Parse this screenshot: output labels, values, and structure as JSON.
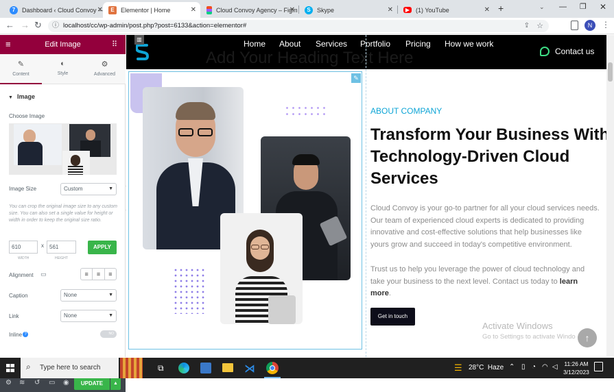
{
  "browser": {
    "tabs": [
      {
        "title": "Dashboard ‹ Cloud Convoy — ",
        "icon": "wordpress-icon",
        "color": "#2d8cff",
        "active": false
      },
      {
        "title": "Elementor | Home",
        "icon": "elementor-icon",
        "color": "#e0733f",
        "active": true
      },
      {
        "title": "Cloud Convoy Agency – Figm",
        "icon": "figma-icon",
        "color": "#f24e1e",
        "active": false
      },
      {
        "title": "Skype",
        "icon": "skype-icon",
        "color": "#00aff0",
        "active": false
      },
      {
        "title": "(1) YouTube",
        "icon": "youtube-icon",
        "color": "#ff0000",
        "active": false
      }
    ],
    "new_tab": "+",
    "url": "localhost/cc/wp-admin/post.php?post=6133&action=elementor#",
    "profile_initial": "N"
  },
  "panel": {
    "title": "Edit Image",
    "tabs": [
      {
        "label": "Content",
        "icon": "pencil-icon"
      },
      {
        "label": "Style",
        "icon": "contrast-icon"
      },
      {
        "label": "Advanced",
        "icon": "gear-icon"
      }
    ],
    "section_title": "Image",
    "choose_image_label": "Choose Image",
    "image_size_label": "Image Size",
    "image_size_value": "Custom",
    "crop_help": "You can crop the original image size to any custom size. You can also set a single value for height or width in order to keep the original size ratio.",
    "width_value": "610",
    "width_caption": "WIDTH",
    "height_value": "561",
    "height_caption": "HEIGHT",
    "times": "x",
    "apply_label": "APPLY",
    "alignment_label": "Alignment",
    "caption_label": "Caption",
    "caption_value": "None",
    "link_label": "Link",
    "link_value": "None",
    "inline_label": "Inline",
    "inline_toggle": "NO",
    "update_label": "UPDATE"
  },
  "site": {
    "nav_items": [
      "Home",
      "About",
      "Services",
      "Portfolio",
      "Pricing",
      "How we work"
    ],
    "contact_label": "Contact us",
    "placeholder_heading": "Add Your Heading Text Here",
    "eyebrow": "ABOUT COMPANY",
    "heading_lines": [
      "Transform Your Business With",
      "Technology-Driven Cloud",
      "Services"
    ],
    "paragraph1": "Cloud Convoy is your go-to partner for all your cloud services needs. Our team of experienced cloud experts is dedicated to providing innovative and cost-effective solutions that help businesses like yours grow and succeed in today's competitive environment.",
    "paragraph2_pre": "Trust us to help you leverage the power of cloud technology and take your business to the next level. Contact us today to ",
    "paragraph2_link": "learn more",
    "paragraph2_post": ".",
    "cta_label": "Get in touch",
    "watermark_title": "Activate Windows",
    "watermark_sub": "Go to Settings to activate Windo"
  },
  "taskbar": {
    "search_placeholder": "Type here to search",
    "weather": "28°C  Haze",
    "time": "11:26 AM",
    "date": "3/12/2023"
  },
  "colors": {
    "elementor_maroon": "#93003c",
    "apply_green": "#39b54a",
    "eyebrow_blue": "#0ea5d6",
    "contact_green": "#3ddc84"
  }
}
